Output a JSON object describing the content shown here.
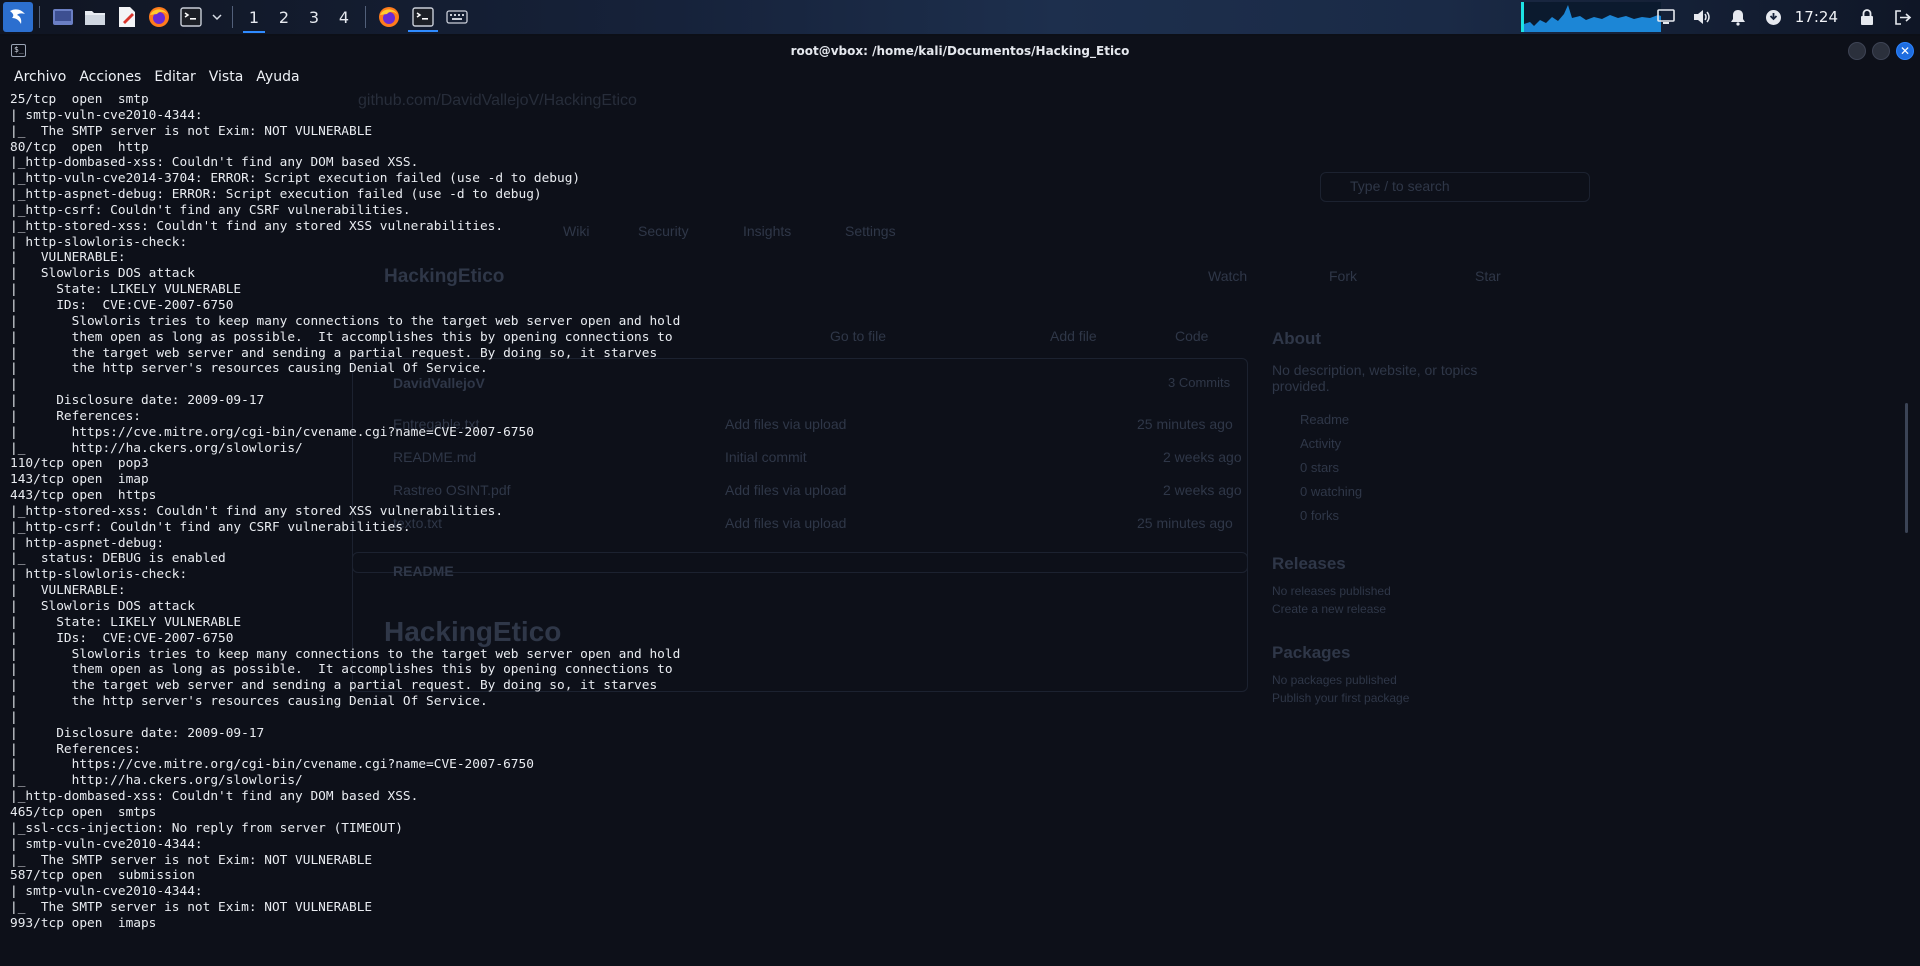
{
  "taskbar": {
    "workspaces": [
      "1",
      "2",
      "3",
      "4"
    ],
    "active_workspace_index": 0,
    "clock": "17:24",
    "accent_color": "#2f8bff",
    "cpu_graph_color": "#1de3e3"
  },
  "window": {
    "title": "root@vbox: /home/kali/Documentos/Hacking_Etico",
    "icon_glyph": "$_",
    "close_glyph": "✕"
  },
  "menu": {
    "items": [
      "Archivo",
      "Acciones",
      "Editar",
      "Vista",
      "Ayuda"
    ]
  },
  "terminal": {
    "lines": [
      "25/tcp  open  smtp",
      "| smtp-vuln-cve2010-4344:",
      "|_  The SMTP server is not Exim: NOT VULNERABLE",
      "80/tcp  open  http",
      "|_http-dombased-xss: Couldn't find any DOM based XSS.",
      "|_http-vuln-cve2014-3704: ERROR: Script execution failed (use -d to debug)",
      "|_http-aspnet-debug: ERROR: Script execution failed (use -d to debug)",
      "|_http-csrf: Couldn't find any CSRF vulnerabilities.",
      "|_http-stored-xss: Couldn't find any stored XSS vulnerabilities.",
      "| http-slowloris-check:",
      "|   VULNERABLE:",
      "|   Slowloris DOS attack",
      "|     State: LIKELY VULNERABLE",
      "|     IDs:  CVE:CVE-2007-6750",
      "|       Slowloris tries to keep many connections to the target web server open and hold",
      "|       them open as long as possible.  It accomplishes this by opening connections to",
      "|       the target web server and sending a partial request. By doing so, it starves",
      "|       the http server's resources causing Denial Of Service.",
      "|",
      "|     Disclosure date: 2009-09-17",
      "|     References:",
      "|       https://cve.mitre.org/cgi-bin/cvename.cgi?name=CVE-2007-6750",
      "|_      http://ha.ckers.org/slowloris/",
      "110/tcp open  pop3",
      "143/tcp open  imap",
      "443/tcp open  https",
      "|_http-stored-xss: Couldn't find any stored XSS vulnerabilities.",
      "|_http-csrf: Couldn't find any CSRF vulnerabilities.",
      "| http-aspnet-debug:",
      "|_  status: DEBUG is enabled",
      "| http-slowloris-check:",
      "|   VULNERABLE:",
      "|   Slowloris DOS attack",
      "|     State: LIKELY VULNERABLE",
      "|     IDs:  CVE:CVE-2007-6750",
      "|       Slowloris tries to keep many connections to the target web server open and hold",
      "|       them open as long as possible.  It accomplishes this by opening connections to",
      "|       the target web server and sending a partial request. By doing so, it starves",
      "|       the http server's resources causing Denial Of Service.",
      "|",
      "|     Disclosure date: 2009-09-17",
      "|     References:",
      "|       https://cve.mitre.org/cgi-bin/cvename.cgi?name=CVE-2007-6750",
      "|_      http://ha.ckers.org/slowloris/",
      "|_http-dombased-xss: Couldn't find any DOM based XSS.",
      "465/tcp open  smtps",
      "|_ssl-ccs-injection: No reply from server (TIMEOUT)",
      "| smtp-vuln-cve2010-4344:",
      "|_  The SMTP server is not Exim: NOT VULNERABLE",
      "587/tcp open  submission",
      "| smtp-vuln-cve2010-4344:",
      "|_  The SMTP server is not Exim: NOT VULNERABLE",
      "993/tcp open  imaps"
    ]
  },
  "background_page": {
    "url": "github.com/DavidVallejoV/HackingEtico",
    "repo_name": "HackingEtico",
    "search_placeholder": "Type / to search",
    "tabs": [
      "Wiki",
      "Security",
      "Insights",
      "Settings"
    ],
    "actions": [
      "Watch",
      "Fork",
      "Star"
    ],
    "buttons": [
      "Go to file",
      "Add file",
      "Code"
    ],
    "commit_author": "DavidVallejoV",
    "commits_label": "3 Commits",
    "files": [
      {
        "name": "Entregable.txt",
        "message": "Add files via upload",
        "time": "25 minutes ago"
      },
      {
        "name": "README.md",
        "message": "Initial commit",
        "time": "2 weeks ago"
      },
      {
        "name": "Rastreo OSINT.pdf",
        "message": "Add files via upload",
        "time": "2 weeks ago"
      },
      {
        "name": "texto.txt",
        "message": "Add files via upload",
        "time": "25 minutes ago"
      }
    ],
    "readme_label": "README",
    "readme_heading": "HackingEtico",
    "about": {
      "heading": "About",
      "description": "No description, website, or topics provided.",
      "items": [
        "Readme",
        "Activity",
        "0 stars",
        "0 watching",
        "0 forks"
      ]
    },
    "releases": {
      "heading": "Releases",
      "text": "No releases published",
      "link": "Create a new release"
    },
    "packages": {
      "heading": "Packages",
      "text": "No packages published",
      "link": "Publish your first package"
    }
  }
}
